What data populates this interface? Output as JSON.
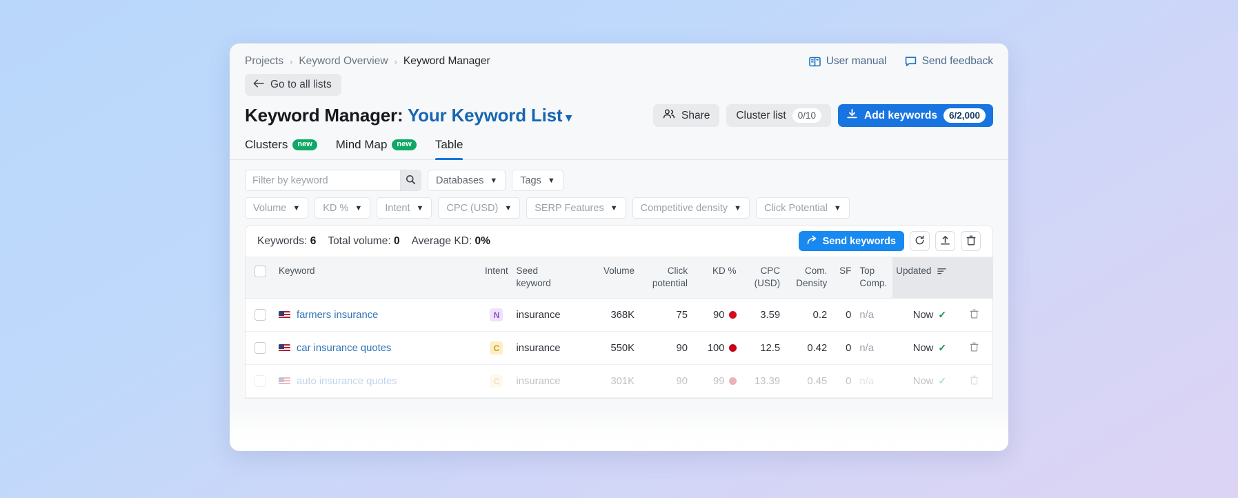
{
  "header": {
    "breadcrumbs": [
      {
        "label": "Projects"
      },
      {
        "label": "Keyword Overview"
      },
      {
        "label": "Keyword Manager"
      }
    ],
    "separator": "›",
    "user_manual": "User manual",
    "send_feedback": "Send feedback",
    "back_button": "Go to all lists",
    "title_prefix": "Keyword Manager:",
    "title_list": "Your Keyword List",
    "title_caret": "⌄"
  },
  "title_actions": {
    "share": "Share",
    "cluster_list": "Cluster list",
    "cluster_list_count": "0/10",
    "add_keywords": "Add keywords",
    "add_keywords_count": "6/2,000"
  },
  "tabs": [
    {
      "label": "Clusters",
      "badge": "new",
      "active": false
    },
    {
      "label": "Mind Map",
      "badge": "new",
      "active": false
    },
    {
      "label": "Table",
      "badge": "",
      "active": true
    }
  ],
  "filters": {
    "search_placeholder": "Filter by keyword",
    "search_value": "",
    "row1": [
      "Databases",
      "Tags"
    ],
    "row2": [
      "Volume",
      "KD %",
      "Intent",
      "CPC (USD)",
      "SERP Features",
      "Competitive density",
      "Click Potential"
    ]
  },
  "stats": {
    "keywords_label": "Keywords:",
    "keywords_value": "6",
    "total_volume_label": "Total volume:",
    "total_volume_value": "0",
    "average_kd_label": "Average KD:",
    "average_kd_value": "0%",
    "send_keywords": "Send keywords"
  },
  "table": {
    "columns": [
      {
        "key": "keyword",
        "l1": "Keyword",
        "l2": ""
      },
      {
        "key": "intent",
        "l1": "Intent",
        "l2": ""
      },
      {
        "key": "seed",
        "l1": "Seed",
        "l2": "keyword"
      },
      {
        "key": "volume",
        "l1": "Volume",
        "l2": ""
      },
      {
        "key": "click",
        "l1": "Click",
        "l2": "potential"
      },
      {
        "key": "kd",
        "l1": "KD %",
        "l2": ""
      },
      {
        "key": "cpc",
        "l1": "CPC",
        "l2": "(USD)"
      },
      {
        "key": "density",
        "l1": "Com.",
        "l2": "Density"
      },
      {
        "key": "sf",
        "l1": "SF",
        "l2": ""
      },
      {
        "key": "top",
        "l1": "Top",
        "l2": "Comp."
      },
      {
        "key": "updated",
        "l1": "Updated",
        "l2": ""
      }
    ],
    "rows": [
      {
        "keyword": "farmers insurance",
        "flag": "us-flag-icon",
        "intent": "N",
        "intent_type": "N",
        "seed": "insurance",
        "volume": "368K",
        "click": "75",
        "kd": "90",
        "kd_color": "#d30b1c",
        "cpc": "3.59",
        "density": "0.2",
        "sf": "0",
        "top": "n/a",
        "updated": "Now",
        "faded": false
      },
      {
        "keyword": "car insurance quotes",
        "flag": "us-flag-icon",
        "intent": "C",
        "intent_type": "C",
        "seed": "insurance",
        "volume": "550K",
        "click": "90",
        "kd": "100",
        "kd_color": "#c60016",
        "cpc": "12.5",
        "density": "0.42",
        "sf": "0",
        "top": "n/a",
        "updated": "Now",
        "faded": false
      },
      {
        "keyword": "auto insurance quotes",
        "flag": "us-flag-icon",
        "intent": "C",
        "intent_type": "C",
        "seed": "insurance",
        "volume": "301K",
        "click": "90",
        "kd": "99",
        "kd_color": "#c60016",
        "cpc": "13.39",
        "density": "0.45",
        "sf": "0",
        "top": "n/a",
        "updated": "Now",
        "faded": true
      }
    ]
  },
  "colors": {
    "accent_blue": "#1874e0",
    "send_blue": "#1889f0",
    "badge_green": "#0fa866",
    "link_blue": "#2e74b5",
    "page_bg_start": "#b9d7fb",
    "page_bg_end": "#ddd4f4"
  }
}
